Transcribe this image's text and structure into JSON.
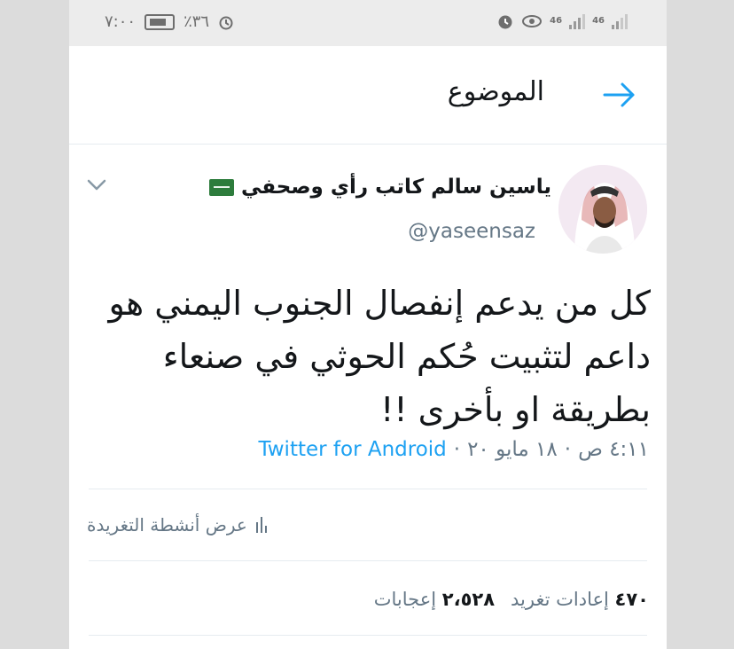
{
  "status_bar": {
    "time": "٧:٠٠",
    "battery_percent": "٪٣٦",
    "network_1": "46",
    "network_2": "46"
  },
  "header": {
    "title": "الموضوع"
  },
  "tweet": {
    "author_name": "ياسين سالم كاتب رأي وصحفي",
    "handle": "@yaseensaz",
    "text_lines": [
      "كل من يدعم إنفصال الجنوب اليمني هو",
      "داعم لتثبيت حُكم الحوثي في صنعاء",
      "بطريقة او بأخرى !!"
    ],
    "time": "٤:١١ ص",
    "date": "١٨ مايو ٢٠",
    "separator": "·",
    "source": "Twitter for Android",
    "activity_label": "عرض أنشطة التغريدة",
    "retweets_count": "٤٧٠",
    "retweets_label": "إعادات تغريد",
    "likes_count": "٢،٥٢٨",
    "likes_label": "إعجابات"
  },
  "colors": {
    "accent": "#1da1f2",
    "text": "#14171a",
    "muted": "#657786"
  }
}
